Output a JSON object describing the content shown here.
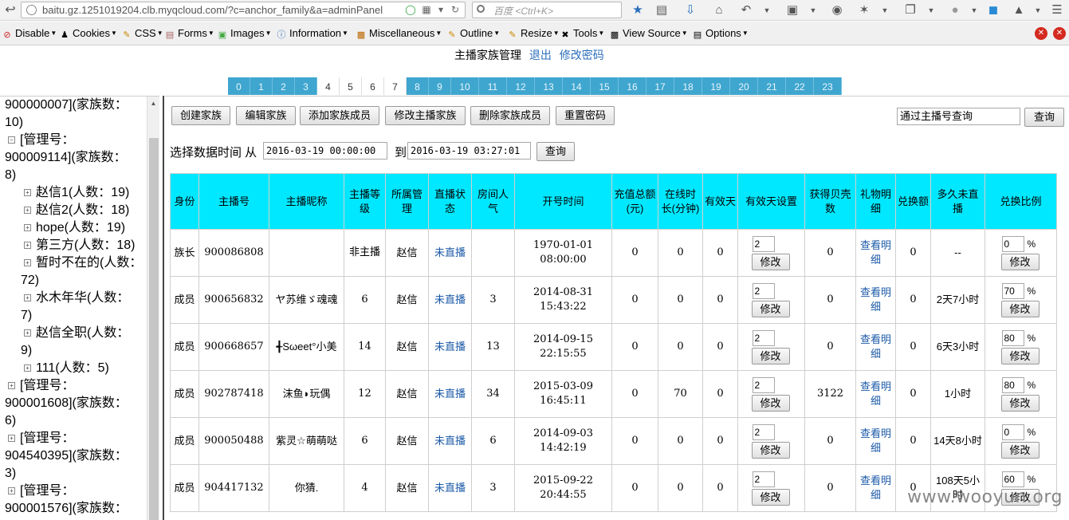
{
  "browser": {
    "url": "baitu.gz.1251019204.clb.myqcloud.com/?c=anchor_family&a=adminPanel",
    "search_placeholder": "百度 <Ctrl+K>"
  },
  "devbar": {
    "items": [
      "Disable",
      "Cookies",
      "CSS",
      "Forms",
      "Images",
      "Information",
      "Miscellaneous",
      "Outline",
      "Resize",
      "Tools",
      "View Source",
      "Options"
    ]
  },
  "header": {
    "title": "主播家族管理",
    "logout": "退出",
    "change_password": "修改密码"
  },
  "hour_tabs": [
    "0",
    "1",
    "2",
    "3",
    "4",
    "5",
    "6",
    "7",
    "8",
    "9",
    "10",
    "11",
    "12",
    "13",
    "14",
    "15",
    "16",
    "17",
    "18",
    "19",
    "20",
    "21",
    "22",
    "23"
  ],
  "tree": {
    "lines": [
      "900000007](家族数：",
      "10)",
      "[管理号：",
      "900009114](家族数：",
      "8)",
      "赵信1(人数：19)",
      "赵信2(人数：18)",
      "hope(人数：19)",
      "第三方(人数：18)",
      "暂时不在的(人数：",
      "72)",
      "水木年华(人数：",
      "7)",
      "赵信全职(人数：",
      "9)",
      "111(人数：5)",
      "[管理号：",
      "900001608](家族数：",
      "6)",
      "[管理号：",
      "904540395](家族数：",
      "3)",
      "[管理号：",
      "900001576](家族数："
    ]
  },
  "toolbar": {
    "create_family": "创建家族",
    "edit_family": "编辑家族",
    "add_member": "添加家族成员",
    "modify_anchor_family": "修改主播家族",
    "delete_member": "删除家族成员",
    "reset_password": "重置密码",
    "search_by_anchor": "通过主播号查询",
    "query": "查询"
  },
  "date_filter": {
    "label": "选择数据时间 从",
    "from": "2016-03-19 00:00:00",
    "to_label": "到",
    "to": "2016-03-19 03:27:01",
    "query": "查询"
  },
  "table": {
    "headers": [
      "身份",
      "主播号",
      "主播昵称",
      "主播等级",
      "所属管理",
      "直播状态",
      "房间人气",
      "开号时间",
      "充值总额(元)",
      "在线时长(分钟)",
      "有效天",
      "有效天设置",
      "获得贝壳数",
      "礼物明细",
      "兑换额",
      "多久未直播",
      "兑换比例"
    ],
    "modify": "修改",
    "rows": [
      {
        "role": "族长",
        "id": "900086808",
        "nick": "",
        "level": "非主播",
        "mgr": "赵信",
        "status": "未直播",
        "pop": "",
        "open_date": "1970-01-01",
        "open_time": "08:00:00",
        "recharge": "0",
        "online": "0",
        "valid_days": "0",
        "valid_set": "2",
        "shells": "0",
        "gift": "查看明细",
        "exchange": "0",
        "idle": "--",
        "ratio": "0"
      },
      {
        "role": "成员",
        "id": "900656832",
        "nick": "ヤ苏维ゞ魂魂",
        "level": "6",
        "mgr": "赵信",
        "status": "未直播",
        "pop": "3",
        "open_date": "2014-08-31",
        "open_time": "15:43:22",
        "recharge": "0",
        "online": "0",
        "valid_days": "0",
        "valid_set": "2",
        "shells": "0",
        "gift": "查看明细",
        "exchange": "0",
        "idle": "2天7小时",
        "ratio": "70"
      },
      {
        "role": "成员",
        "id": "900668657",
        "nick": "╉Sωeet°小美",
        "level": "14",
        "mgr": "赵信",
        "status": "未直播",
        "pop": "13",
        "open_date": "2014-09-15",
        "open_time": "22:15:55",
        "recharge": "0",
        "online": "0",
        "valid_days": "0",
        "valid_set": "2",
        "shells": "0",
        "gift": "查看明细",
        "exchange": "0",
        "idle": "6天3小时",
        "ratio": "80"
      },
      {
        "role": "成员",
        "id": "902787418",
        "nick": "沫鱼◗玩偶",
        "level": "12",
        "mgr": "赵信",
        "status": "未直播",
        "pop": "34",
        "open_date": "2015-03-09",
        "open_time": "16:45:11",
        "recharge": "0",
        "online": "70",
        "valid_days": "0",
        "valid_set": "2",
        "shells": "3122",
        "gift": "查看明细",
        "exchange": "0",
        "idle": "1小时",
        "ratio": "80"
      },
      {
        "role": "成员",
        "id": "900050488",
        "nick": "紫灵☆萌萌哒",
        "level": "6",
        "mgr": "赵信",
        "status": "未直播",
        "pop": "6",
        "open_date": "2014-09-03",
        "open_time": "14:42:19",
        "recharge": "0",
        "online": "0",
        "valid_days": "0",
        "valid_set": "2",
        "shells": "0",
        "gift": "查看明细",
        "exchange": "0",
        "idle": "14天8小时",
        "ratio": "0"
      },
      {
        "role": "成员",
        "id": "904417132",
        "nick": "你猜.",
        "level": "4",
        "mgr": "赵信",
        "status": "未直播",
        "pop": "3",
        "open_date": "2015-09-22",
        "open_time": "20:44:55",
        "recharge": "0",
        "online": "0",
        "valid_days": "0",
        "valid_set": "2",
        "shells": "0",
        "gift": "查看明细",
        "exchange": "0",
        "idle": "108天5小时",
        "ratio": "60"
      }
    ]
  },
  "watermark": "www.wooyun.org"
}
